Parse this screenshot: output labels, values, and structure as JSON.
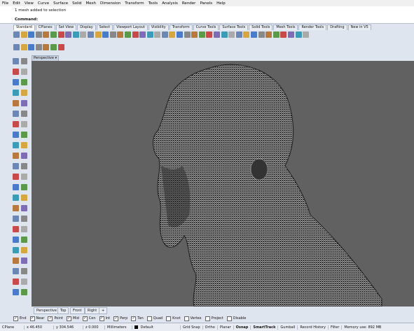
{
  "menu": [
    "File",
    "Edit",
    "View",
    "Curve",
    "Surface",
    "Solid",
    "Mesh",
    "Dimension",
    "Transform",
    "Tools",
    "Analysis",
    "Render",
    "Panels",
    "Help"
  ],
  "history": "1 mesh added to selection",
  "command": "Command:",
  "toolbar_tabs": [
    "Standard",
    "CPlanes",
    "Set View",
    "Display",
    "Select",
    "Viewport Layout",
    "Visibility",
    "Transform",
    "Curve Tools",
    "Surface Tools",
    "Solid Tools",
    "Mesh Tools",
    "Render Tools",
    "Drafting",
    "New in V5"
  ],
  "toolbar1_icons": [
    "new-file-icon",
    "open-icon",
    "save-icon",
    "print-icon",
    "import-icon",
    "cut-icon",
    "copy-icon",
    "paste-icon",
    "undo-icon",
    "select-icon",
    "pan-icon",
    "rotate-view-icon",
    "zoom-icon",
    "zoom-window-icon",
    "zoom-extents-icon",
    "zoom-selected-icon",
    "undo-view-icon",
    "four-views-icon",
    "cplane-icon",
    "grid-icon",
    "properties-icon",
    "layer-icon",
    "material-icon",
    "render-icon",
    "lights-icon",
    "sphere-icon",
    "circle-icon",
    "globe-icon",
    "settings-icon",
    "help-icon",
    "options-icon",
    "arrow-icon",
    "snap-icon",
    "point-icon",
    "line-icon",
    "curve-icon",
    "analyze-icon",
    "color-icon",
    "gear-icon",
    "globe2-icon"
  ],
  "toolbar2_icons": [
    "red-sphere-icon",
    "blue-sphere-icon",
    "shield-icon",
    "green-render-icon",
    "warning-icon",
    "frame-icon",
    "bulb-icon"
  ],
  "viewport_title": "Perspective",
  "viewport_tabs": [
    "Perspective",
    "Top",
    "Front",
    "Right",
    "+"
  ],
  "osnaps": [
    {
      "label": "End",
      "checked": true
    },
    {
      "label": "Near",
      "checked": true
    },
    {
      "label": "Point",
      "checked": true
    },
    {
      "label": "Mid",
      "checked": true
    },
    {
      "label": "Cen",
      "checked": true
    },
    {
      "label": "Int",
      "checked": true
    },
    {
      "label": "Perp",
      "checked": true
    },
    {
      "label": "Tan",
      "checked": true
    },
    {
      "label": "Quad",
      "checked": false
    },
    {
      "label": "Knot",
      "checked": false
    },
    {
      "label": "Vertex",
      "checked": false
    },
    {
      "label": "Project",
      "checked": false
    },
    {
      "label": "Disable",
      "checked": false
    }
  ],
  "status": {
    "cplane": "CPlane",
    "x": "x 46.450",
    "y": "y 304.546",
    "z": "z 0.000",
    "units": "Millimeters",
    "layer": "Default",
    "grid_snap": "Grid Snap",
    "ortho": "Ortho",
    "planar": "Planar",
    "osnap": "Osnap",
    "smarttrack": "SmartTrack",
    "gumball": "Gumball",
    "record_history": "Record History",
    "filter": "Filter",
    "memory": "Memory use: 892 MB"
  }
}
